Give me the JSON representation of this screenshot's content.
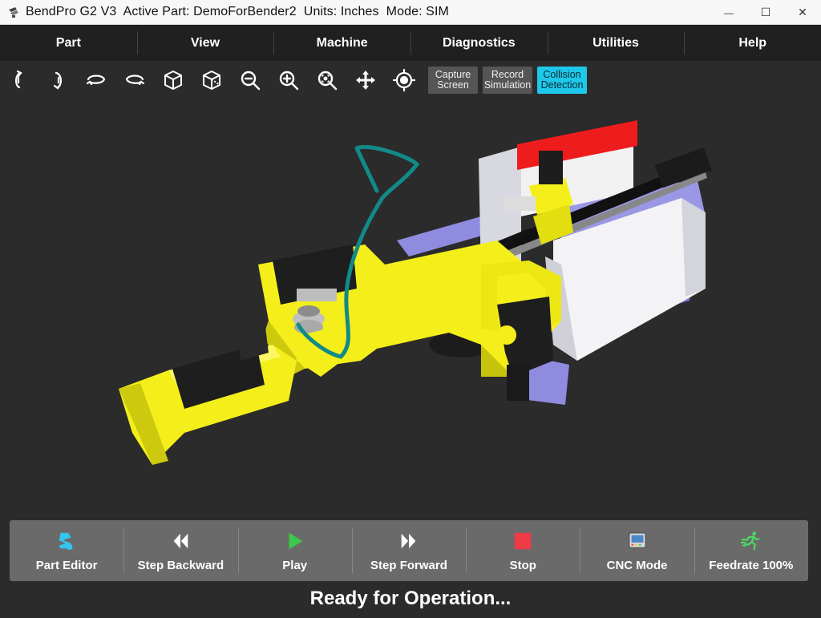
{
  "window": {
    "title": "BendPro G2 V3  Active Part: DemoForBender2  Units: Inches  Mode: SIM",
    "minimize": "—",
    "maximize": "☐",
    "close": "✕"
  },
  "menu": {
    "items": [
      {
        "label": "Part"
      },
      {
        "label": "View"
      },
      {
        "label": "Machine"
      },
      {
        "label": "Diagnostics"
      },
      {
        "label": "Utilities"
      },
      {
        "label": "Help"
      }
    ]
  },
  "toolbar": {
    "icons": [
      "rotate-up-icon",
      "rotate-down-icon",
      "rotate-left-icon",
      "rotate-right-icon",
      "iso-view-icon",
      "iso-view-alt-icon",
      "zoom-out-icon",
      "zoom-in-icon",
      "zoom-fit-icon",
      "pan-icon",
      "center-target-icon"
    ],
    "capture_line1": "Capture",
    "capture_line2": "Screen",
    "record_line1": "Record",
    "record_line2": "Simulation",
    "collision_line1": "Collision",
    "collision_line2": "Detection",
    "collision_active_color": "#1ec8ea"
  },
  "controls": {
    "part_editor": "Part Editor",
    "step_backward": "Step Backward",
    "play": "Play",
    "step_forward": "Step Forward",
    "stop": "Stop",
    "cnc_mode": "CNC Mode",
    "feedrate": "Feedrate 100%"
  },
  "colors": {
    "machine_yellow": "#f4ef1a",
    "tube_teal": "#118a88",
    "frame_white": "#efefef",
    "guard_red": "#ee1c1c",
    "base_purple": "#8f8ce0",
    "play_green": "#3cc94a",
    "stop_red": "#ee3b46",
    "part_editor_cyan": "#34c6ef"
  },
  "status": {
    "text": "Ready for Operation..."
  }
}
